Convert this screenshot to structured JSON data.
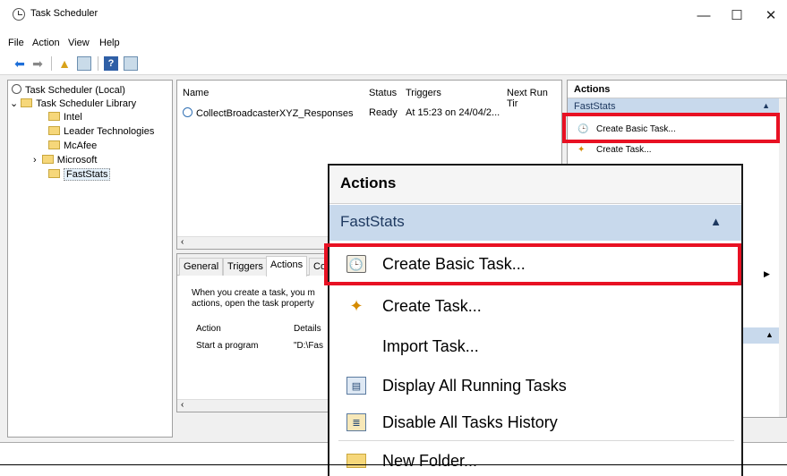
{
  "window": {
    "title": "Task Scheduler",
    "controls": {
      "minimize": "—",
      "maximize": "☐",
      "close": "✕"
    }
  },
  "menubar": {
    "items": [
      "File",
      "Action",
      "View",
      "Help"
    ]
  },
  "toolbar": {
    "icons": [
      "back-arrow-icon",
      "forward-arrow-icon",
      "folder-up-icon",
      "properties-icon",
      "help-icon",
      "console-tree-icon"
    ]
  },
  "tree": {
    "root": "Task Scheduler (Local)",
    "library": "Task Scheduler Library",
    "folders": [
      "Intel",
      "Leader Technologies",
      "McAfee",
      "Microsoft",
      "FastStats"
    ],
    "selected": "FastStats"
  },
  "task_list": {
    "columns": [
      "Name",
      "Status",
      "Triggers",
      "Next Run Tir"
    ],
    "rows": [
      {
        "name": "CollectBroadcasterXYZ_Responses",
        "status": "Ready",
        "triggers": "At 15:23 on 24/04/2..."
      }
    ]
  },
  "details": {
    "tabs": [
      "General",
      "Triggers",
      "Actions",
      "Co"
    ],
    "active_tab": "Actions",
    "description_line1": "When you create a task, you m",
    "description_line2": "actions, open the task property",
    "columns": [
      "Action",
      "Details"
    ],
    "rows": [
      {
        "action": "Start a program",
        "details": "\"D:\\Fas"
      }
    ]
  },
  "actions_small": {
    "header": "Actions",
    "group": "FastStats",
    "items": [
      "Create Basic Task...",
      "Create Task..."
    ]
  },
  "actions_zoom": {
    "header": "Actions",
    "group": "FastStats",
    "items": [
      {
        "label": "Create Basic Task...",
        "icon": "create-basic-task-icon"
      },
      {
        "label": "Create Task...",
        "icon": "create-task-icon"
      },
      {
        "label": "Import Task...",
        "icon": ""
      },
      {
        "label": "Display All Running Tasks",
        "icon": "running-tasks-icon"
      },
      {
        "label": "Disable All Tasks History",
        "icon": "history-icon"
      },
      {
        "label": "New Folder...",
        "icon": "new-folder-icon"
      }
    ]
  },
  "colors": {
    "highlight_red": "#e81123",
    "group_header_blue": "#c8d9ec"
  }
}
